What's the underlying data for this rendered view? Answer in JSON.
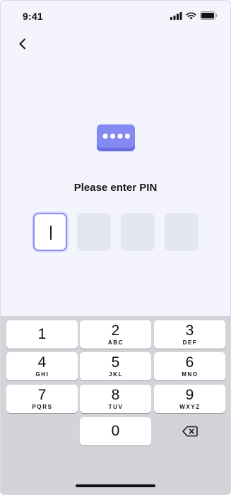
{
  "status_bar": {
    "time": "9:41"
  },
  "pin_screen": {
    "title": "Please enter PIN",
    "accent_color": "#7b7ff0",
    "pin_length": 4,
    "entered_digits": 0
  },
  "keyboard": {
    "keys": [
      {
        "digit": "1",
        "letters": ""
      },
      {
        "digit": "2",
        "letters": "ABC"
      },
      {
        "digit": "3",
        "letters": "DEF"
      },
      {
        "digit": "4",
        "letters": "GHI"
      },
      {
        "digit": "5",
        "letters": "JKL"
      },
      {
        "digit": "6",
        "letters": "MNO"
      },
      {
        "digit": "7",
        "letters": "PQRS"
      },
      {
        "digit": "8",
        "letters": "TUV"
      },
      {
        "digit": "9",
        "letters": "WXYZ"
      },
      {
        "digit": "0",
        "letters": ""
      }
    ]
  }
}
